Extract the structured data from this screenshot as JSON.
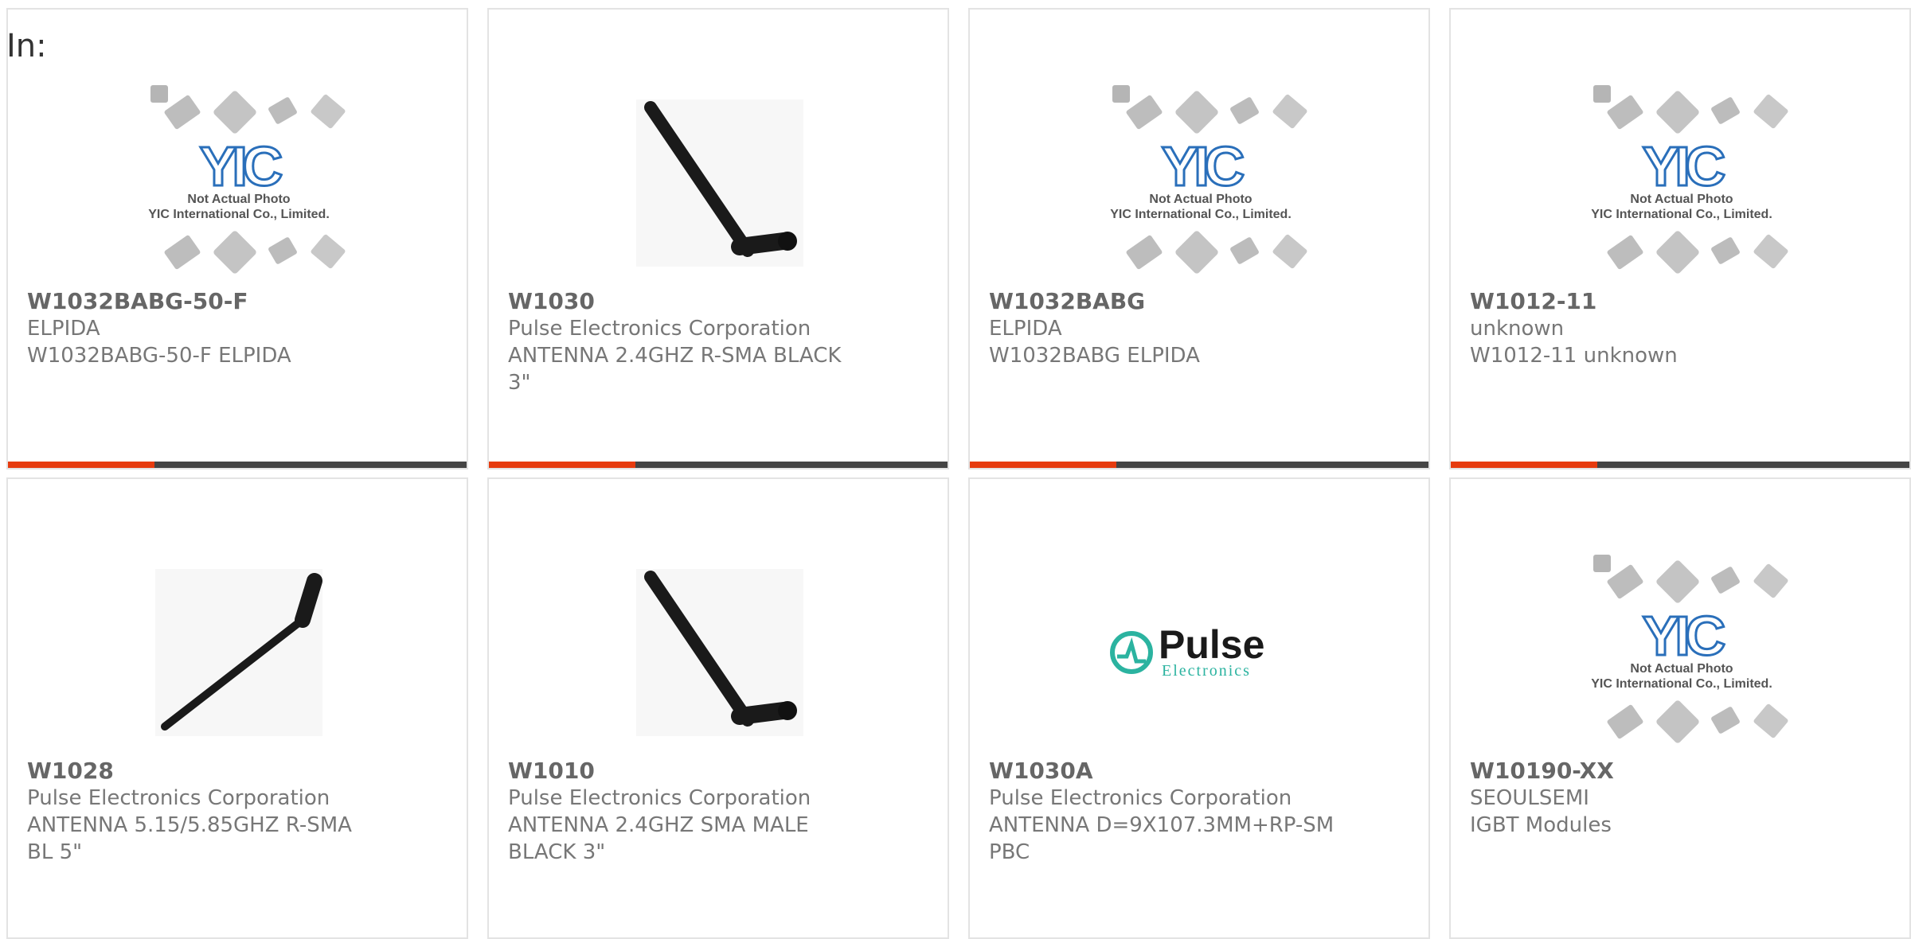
{
  "header": {
    "in_label": "In:"
  },
  "accent": "#e63b0f",
  "bar_base": "#444444",
  "placeholder_art": {
    "line1": "Not Actual Photo",
    "line2": "YIC International Co., Limited.",
    "brand": "YIC"
  },
  "pulse_logo": {
    "word": "Pulse",
    "sub": "Electronics"
  },
  "products": [
    {
      "part": "W1032BABG-50-F",
      "manufacturer": "ELPIDA",
      "description": "W1032BABG-50-F ELPIDA",
      "image": "yic-placeholder",
      "progress": 0.32
    },
    {
      "part": "W1030",
      "manufacturer": "Pulse Electronics Corporation",
      "description": "ANTENNA 2.4GHZ R-SMA BLACK\n3\"",
      "image": "antenna-tilted",
      "progress": 0.32
    },
    {
      "part": "W1032BABG",
      "manufacturer": "ELPIDA",
      "description": "W1032BABG ELPIDA",
      "image": "yic-placeholder",
      "progress": 0.32
    },
    {
      "part": "W1012-11",
      "manufacturer": "unknown",
      "description": "W1012-11 unknown",
      "image": "yic-placeholder",
      "progress": 0.32
    },
    {
      "part": "W1028",
      "manufacturer": "Pulse Electronics Corporation",
      "description": "ANTENNA 5.15/5.85GHZ R-SMA\nBL 5\"",
      "image": "antenna-rising",
      "progress": 0
    },
    {
      "part": "W1010",
      "manufacturer": "Pulse Electronics Corporation",
      "description": "ANTENNA 2.4GHZ SMA MALE\nBLACK 3\"",
      "image": "antenna-tilted",
      "progress": 0
    },
    {
      "part": "W1030A",
      "manufacturer": "Pulse Electronics Corporation",
      "description": "ANTENNA D=9X107.3MM+RP-SM\nPBC",
      "image": "pulse-logo",
      "progress": 0
    },
    {
      "part": "W10190-XX",
      "manufacturer": "SEOULSEMI",
      "description": "IGBT Modules",
      "image": "yic-placeholder",
      "progress": 0
    }
  ]
}
